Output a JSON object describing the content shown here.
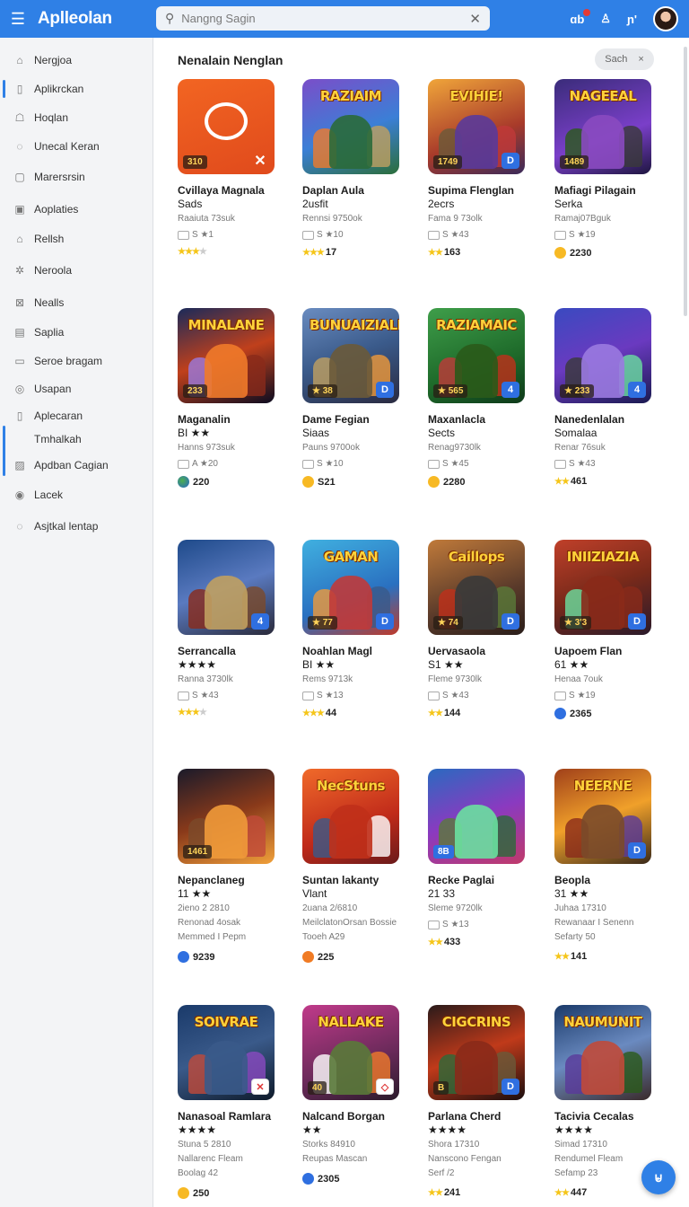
{
  "app": {
    "title": "Aplleolan",
    "menu_icon": "menu-icon"
  },
  "search": {
    "placeholder": "Nangng Sagin"
  },
  "topbar": {
    "icon1": "ɑb",
    "icon2": "♙",
    "icon3": "ɲ'"
  },
  "sidebar": {
    "items": [
      {
        "label": "Nergjoa",
        "icon": "⌂"
      },
      {
        "label": "Aplikrckan",
        "icon": "▯"
      },
      {
        "label": "Hoqlan",
        "icon": "☖"
      },
      {
        "label": "Unecal Keran",
        "icon": "◌"
      },
      {
        "label": "Marersrsin",
        "icon": "▢"
      },
      {
        "label": "Aoplaties",
        "icon": "▣"
      },
      {
        "label": "Rellsh",
        "icon": "⌂"
      },
      {
        "label": "Neroola",
        "icon": "✲"
      },
      {
        "label": "Nealls",
        "icon": "⊠"
      },
      {
        "label": "Saplia",
        "icon": "▤"
      },
      {
        "label": "Seroe bragam",
        "icon": "▭"
      },
      {
        "label": "Usapan",
        "icon": "◎"
      },
      {
        "label": "Aplecaran",
        "icon": "▯"
      },
      {
        "label": "Tmhalkah",
        "icon": ""
      },
      {
        "label": "Apdban Cagian",
        "icon": "▨"
      },
      {
        "label": "Lacek",
        "icon": "◉"
      },
      {
        "label": "Asjtkal lentap",
        "icon": "◌"
      }
    ]
  },
  "main": {
    "section_title": "Nenalain Nenglan",
    "sort_label": "Sach",
    "sort_close": "×"
  },
  "cards": [
    {
      "title": "Cvillaya Magnala",
      "sub": "Sads",
      "meta": "Raaiuta 73suk",
      "info": "S ★1",
      "tag": "310",
      "badge": "✕",
      "foot": "",
      "foot_stars": "★★★",
      "foot_grey": "★",
      "coin": ""
    },
    {
      "title": "Daplan Aula",
      "sub": "2usfit",
      "meta": "Rennsi 9750ok",
      "info": "S ★10",
      "tag": "",
      "badge": "",
      "foot": "17",
      "foot_stars": "★★★",
      "foot_grey": "",
      "coin": "",
      "banner": "RAZIAIM"
    },
    {
      "title": "Supima Flenglan",
      "sub": "2ecrs",
      "meta": "Fama 9 73olk",
      "info": "S ★43",
      "tag": "1749",
      "badge": "D",
      "foot": "163",
      "foot_stars": "★★",
      "foot_grey": "",
      "coin": "",
      "banner": "EVIHIE!"
    },
    {
      "title": "Mafiagi Pilagain",
      "sub": "Serka",
      "meta": "Ramaj07Bguk",
      "info": "S ★19",
      "tag": "1489",
      "badge": "",
      "foot": "2230",
      "foot_stars": "",
      "foot_grey": "",
      "coin": "gold",
      "banner": "NAGEEAL"
    },
    {
      "title": "Maganalin",
      "sub": "BI ★★",
      "meta": "Hanns 973suk",
      "info": "A ★20",
      "tag": "233",
      "badge": "",
      "foot": "220",
      "foot_stars": "",
      "foot_grey": "",
      "coin": "globe",
      "banner": "MINALANE"
    },
    {
      "title": "Dame Fegian",
      "sub": "Siaas",
      "meta": "Pauns 9700ok",
      "info": "S ★10",
      "tag": "★ 38",
      "badge": "D",
      "foot": "S21",
      "foot_stars": "",
      "foot_grey": "",
      "coin": "gold",
      "banner": "BUNUAIZIALE"
    },
    {
      "title": "Maxanlacla",
      "sub": "Sects",
      "meta": "Renag9730lk",
      "info": "S ★45",
      "tag": "★ 565",
      "badge": "4",
      "foot": "2280",
      "foot_stars": "",
      "foot_grey": "",
      "coin": "gold",
      "banner": "RAZIAMAIC"
    },
    {
      "title": "Nanedenlalan",
      "sub": "Somalaa",
      "meta": "Renar 76suk",
      "info": "S ★43",
      "tag": "★ 233",
      "badge": "4",
      "foot": "461",
      "foot_stars": "★★",
      "foot_grey": "",
      "coin": ""
    },
    {
      "title": "Serrancalla",
      "sub": "★★★★",
      "meta": "Ranna 3730lk",
      "info": "S ★43",
      "tag": "",
      "badge": "4",
      "foot": "",
      "foot_stars": "★★★",
      "foot_grey": "★",
      "coin": ""
    },
    {
      "title": "Noahlan Magl",
      "sub": "BI ★★",
      "meta": "Rems 9713k",
      "info": "S ★13",
      "tag": "★ 77",
      "badge": "D",
      "foot": "44",
      "foot_stars": "★★★",
      "foot_grey": "",
      "coin": "",
      "banner": "GAMAN"
    },
    {
      "title": "Uervasaola",
      "sub": "S1 ★★",
      "meta": "Fleme 9730lk",
      "info": "S ★43",
      "tag": "★ 74",
      "badge": "D",
      "foot": "144",
      "foot_stars": "★★",
      "foot_grey": "",
      "coin": "",
      "banner": "Caillops"
    },
    {
      "title": "Uapoem Flan",
      "sub": "61 ★★",
      "meta": "Henaa 7ouk",
      "info": "S ★19",
      "tag": "★ 3'3",
      "badge": "D",
      "foot": "2365",
      "foot_stars": "",
      "foot_grey": "",
      "coin": "blue",
      "banner": "INIIZIAZIA"
    },
    {
      "title": "Nepanclaneg",
      "sub": "11 ★★",
      "meta": "2ieno 2 2810",
      "meta2": "Renonad 4osak",
      "meta3": "Memmed I Pepm",
      "info": "",
      "tag": "1461",
      "badge": "",
      "foot": "9239",
      "foot_stars": "",
      "foot_grey": "",
      "coin": "blue"
    },
    {
      "title": "Suntan lakanty",
      "sub": "Vlant",
      "meta": "2uana 2/6810",
      "meta2": "MeilclatonOrsan Bossie",
      "meta3": "Tooeh A29",
      "info": "",
      "tag": "",
      "badge": "",
      "foot": "225",
      "foot_stars": "",
      "foot_grey": "",
      "coin": "orange",
      "banner": "NecStuns"
    },
    {
      "title": "Recke Paglai",
      "sub": "21 33",
      "meta": "Sleme 9720lk",
      "info": "S ★13",
      "tag": "",
      "badge": "",
      "foot": "433",
      "foot_stars": "★★",
      "foot_grey": "",
      "coin": "",
      "tag_blue": "8B"
    },
    {
      "title": "Beopla",
      "sub": "31 ★★",
      "meta": "Juhaa 17310",
      "meta2": "Rewanaar I Senenn",
      "meta3": "Sefarty 50",
      "info": "",
      "tag": "",
      "badge": "D",
      "foot": "141",
      "foot_stars": "★★",
      "foot_grey": "",
      "coin": "",
      "banner": "NEERNE"
    },
    {
      "title": "Nanasoal Ramlara",
      "sub": "★★★★",
      "meta": "Stuna 5 2810",
      "meta2": "Nallarenc Fleam",
      "meta3": "Boolag 42",
      "info": "",
      "tag": "",
      "badge": "✕",
      "foot": "250",
      "foot_stars": "",
      "foot_grey": "",
      "coin": "gold",
      "banner": "SOIVRAE"
    },
    {
      "title": "Nalcand Borgan",
      "sub": "★★",
      "meta": "Storks 84910",
      "meta2": "Reupas Mascan",
      "meta3": "",
      "info": "",
      "tag": "40",
      "badge": "◇",
      "foot": "2305",
      "foot_stars": "",
      "foot_grey": "",
      "coin": "blue",
      "banner": "NALLAKE"
    },
    {
      "title": "Parlana Cherd",
      "sub": "★★★★",
      "meta": "Shora 17310",
      "meta2": "Nanscono Fengan",
      "meta3": "Serf   /2",
      "info": "",
      "tag": "B",
      "badge": "D",
      "foot": "241",
      "foot_stars": "★★",
      "foot_grey": "",
      "coin": "",
      "banner": "CIGCRINS"
    },
    {
      "title": "Tacivia Cecalas",
      "sub": "★★★★",
      "meta": "Simad 17310",
      "meta2": "Rendumel Fleam",
      "meta3": "Sefamp 23",
      "info": "",
      "tag": "",
      "badge": "",
      "foot": "447",
      "foot_stars": "★★",
      "foot_grey": "",
      "coin": "",
      "banner": "NAUMUNIT"
    }
  ],
  "fab": {
    "label": "⊌",
    "icon": "bag-icon"
  },
  "colors": {
    "accent": "#2f80e6",
    "sidebar_bg": "#f3f4f6"
  }
}
